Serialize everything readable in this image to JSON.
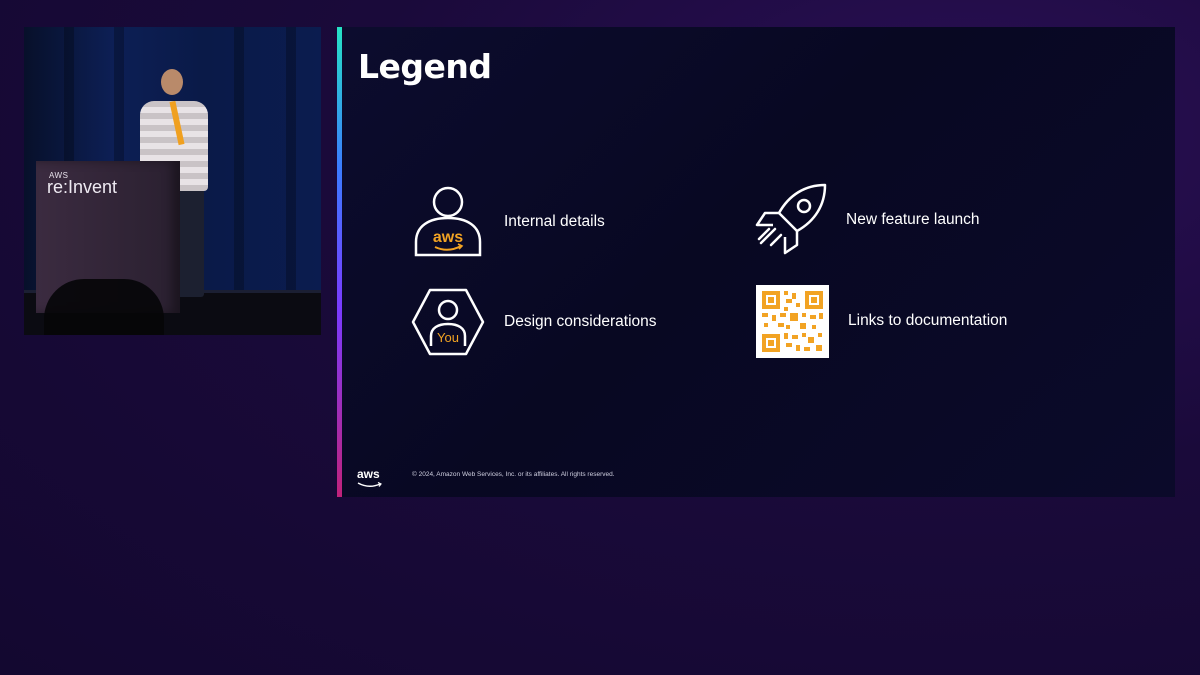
{
  "camera": {
    "podium_small": "AWS",
    "podium_big": "re:Invent"
  },
  "slide": {
    "title": "Legend",
    "items": [
      {
        "label": "Internal details",
        "icon": "person-aws-icon",
        "icon_text": "aws"
      },
      {
        "label": "New feature launch",
        "icon": "rocket-icon"
      },
      {
        "label": "Design considerations",
        "icon": "person-hexagon-you-icon",
        "icon_text": "You"
      },
      {
        "label": "Links to documentation",
        "icon": "qr-code-icon"
      }
    ],
    "footer_logo": "aws",
    "copyright": "© 2024, Amazon Web Services, Inc. or its affiliates. All rights reserved."
  },
  "colors": {
    "accent_orange": "#f2a323",
    "slide_bg": "#080822",
    "page_bg": "#1a0a3a"
  }
}
